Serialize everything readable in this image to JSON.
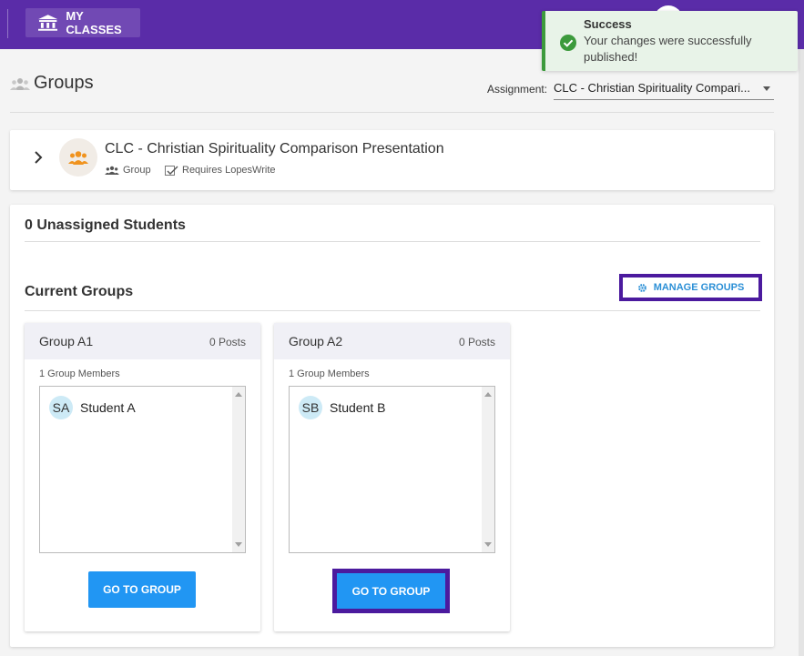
{
  "topbar": {
    "my_classes_label": "MY CLASSES"
  },
  "toast": {
    "title": "Success",
    "message": "Your changes were successfully published!"
  },
  "page": {
    "title": "Groups",
    "assignment_label": "Assignment:",
    "assignment_value": "CLC - Christian Spirituality Compari..."
  },
  "assignment_card": {
    "title": "CLC - Christian Spirituality Comparison Presentation",
    "meta_group": "Group",
    "meta_lopeswrite": "Requires LopesWrite"
  },
  "main": {
    "unassigned": "0 Unassigned Students",
    "current_groups": "Current Groups",
    "manage_groups": "MANAGE GROUPS",
    "groups": [
      {
        "name": "Group A1",
        "posts": "0 Posts",
        "members_label": "1 Group Members",
        "members": [
          {
            "initials": "SA",
            "name": "Student A"
          }
        ],
        "go_label": "GO TO GROUP"
      },
      {
        "name": "Group A2",
        "posts": "0 Posts",
        "members_label": "1 Group Members",
        "members": [
          {
            "initials": "SB",
            "name": "Student B"
          }
        ],
        "go_label": "GO TO GROUP"
      }
    ]
  },
  "colors": {
    "topbar": "#5a2ca8",
    "highlight": "#4b1a9e",
    "primary_button": "#2196f3",
    "toast_border": "#3c9a3c",
    "link": "#2b8fd6"
  },
  "icons": [
    "institution-icon",
    "check-circle-icon",
    "group-icon",
    "chevron-right-icon",
    "lopeswrite-icon",
    "gear-icon"
  ]
}
